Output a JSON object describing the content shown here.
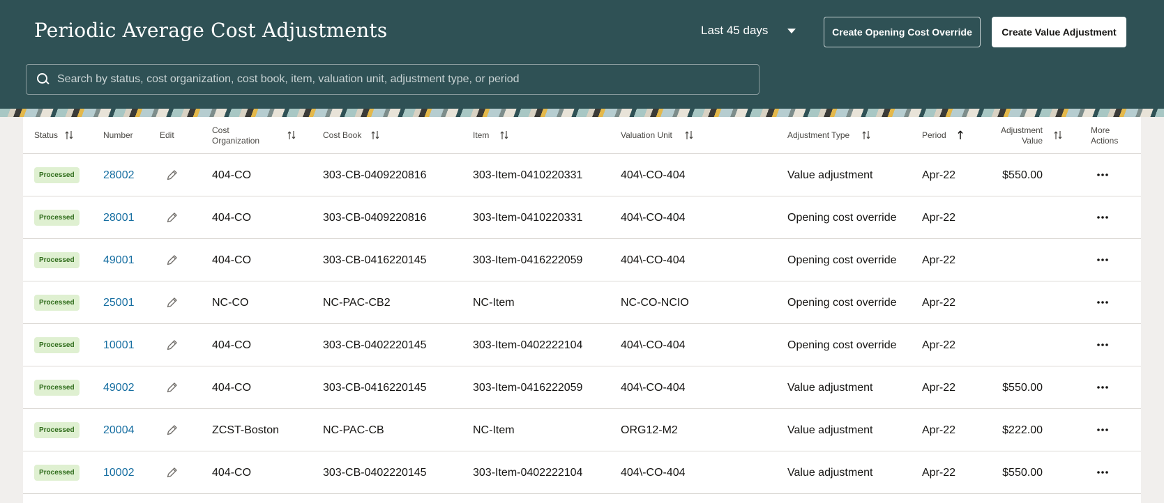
{
  "header": {
    "title": "Periodic Average Cost Adjustments",
    "range_label": "Last 45 days",
    "create_override_label": "Create Opening Cost Override",
    "create_value_label": "Create Value Adjustment",
    "search_placeholder": "Search by status, cost organization, cost book, item, valuation unit, adjustment type, or period"
  },
  "table": {
    "columns": {
      "status": "Status",
      "number": "Number",
      "edit": "Edit",
      "cost_org_line1": "Cost",
      "cost_org_line2": "Organization",
      "cost_book": "Cost Book",
      "item": "Item",
      "valuation_unit": "Valuation Unit",
      "adjustment_type": "Adjustment Type",
      "period": "Period",
      "adj_value_line1": "Adjustment",
      "adj_value_line2": "Value",
      "more_line1": "More",
      "more_line2": "Actions"
    },
    "rows": [
      {
        "status": "Processed",
        "number": "28002",
        "cost_org": "404-CO",
        "cost_book": "303-CB-0409220816",
        "item": "303-Item-0410220331",
        "valuation_unit": "404\\-CO-404",
        "adjustment_type": "Value adjustment",
        "period": "Apr-22",
        "adjustment_value": "$550.00"
      },
      {
        "status": "Processed",
        "number": "28001",
        "cost_org": "404-CO",
        "cost_book": "303-CB-0409220816",
        "item": "303-Item-0410220331",
        "valuation_unit": "404\\-CO-404",
        "adjustment_type": "Opening cost override",
        "period": "Apr-22",
        "adjustment_value": ""
      },
      {
        "status": "Processed",
        "number": "49001",
        "cost_org": "404-CO",
        "cost_book": "303-CB-0416220145",
        "item": "303-Item-0416222059",
        "valuation_unit": "404\\-CO-404",
        "adjustment_type": "Opening cost override",
        "period": "Apr-22",
        "adjustment_value": ""
      },
      {
        "status": "Processed",
        "number": "25001",
        "cost_org": "NC-CO",
        "cost_book": "NC-PAC-CB2",
        "item": "NC-Item",
        "valuation_unit": "NC-CO-NCIO",
        "adjustment_type": "Opening cost override",
        "period": "Apr-22",
        "adjustment_value": ""
      },
      {
        "status": "Processed",
        "number": "10001",
        "cost_org": "404-CO",
        "cost_book": "303-CB-0402220145",
        "item": "303-Item-0402222104",
        "valuation_unit": "404\\-CO-404",
        "adjustment_type": "Opening cost override",
        "period": "Apr-22",
        "adjustment_value": ""
      },
      {
        "status": "Processed",
        "number": "49002",
        "cost_org": "404-CO",
        "cost_book": "303-CB-0416220145",
        "item": "303-Item-0416222059",
        "valuation_unit": "404\\-CO-404",
        "adjustment_type": "Value adjustment",
        "period": "Apr-22",
        "adjustment_value": "$550.00"
      },
      {
        "status": "Processed",
        "number": "20004",
        "cost_org": "ZCST-Boston",
        "cost_book": "NC-PAC-CB",
        "item": "NC-Item",
        "valuation_unit": "ORG12-M2",
        "adjustment_type": "Value adjustment",
        "period": "Apr-22",
        "adjustment_value": "$222.00"
      },
      {
        "status": "Processed",
        "number": "10002",
        "cost_org": "404-CO",
        "cost_book": "303-CB-0402220145",
        "item": "303-Item-0402222104",
        "valuation_unit": "404\\-CO-404",
        "adjustment_type": "Value adjustment",
        "period": "Apr-22",
        "adjustment_value": "$550.00"
      }
    ]
  },
  "colors": {
    "header_bg": "#2f5155",
    "link": "#166ea1",
    "badge_bg": "#dff0d1",
    "badge_text": "#2e6b1a"
  }
}
